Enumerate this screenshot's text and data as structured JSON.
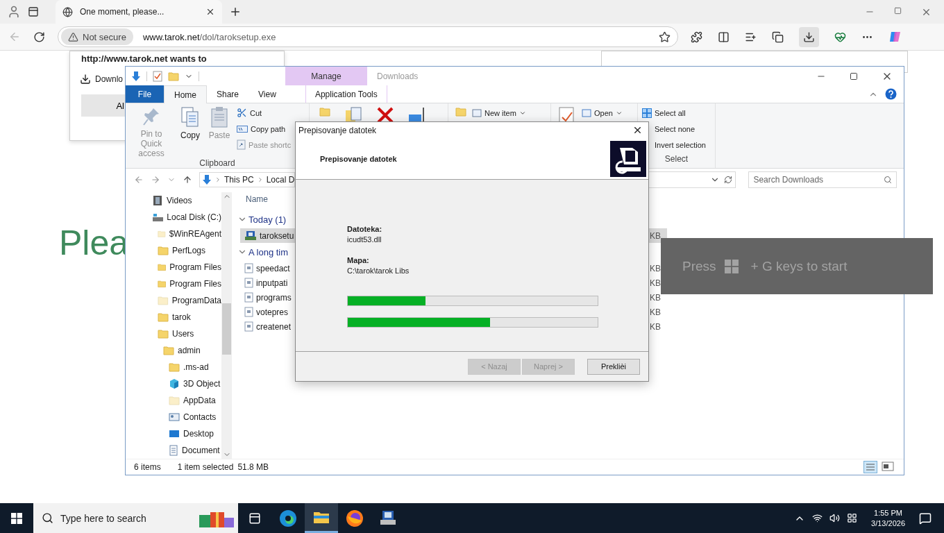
{
  "browser": {
    "tab": {
      "title": "One moment, please..."
    },
    "address": {
      "security": "Not secure",
      "host": "www.tarok.net",
      "path": "/dol/taroksetup.exe"
    },
    "page": {
      "heading": "Plea"
    },
    "download_prompt": {
      "title": "http://www.tarok.net wants to",
      "item": "Downlo",
      "button": "Al"
    }
  },
  "explorer": {
    "context_tab": "Manage",
    "title": "Downloads",
    "tabs": [
      {
        "label": "File",
        "kind": "file",
        "selected": false
      },
      {
        "label": "Home",
        "kind": "tab",
        "selected": true
      },
      {
        "label": "Share",
        "kind": "tab",
        "selected": false
      },
      {
        "label": "View",
        "kind": "tab",
        "selected": false
      },
      {
        "label": "Application Tools",
        "kind": "context",
        "selected": false
      }
    ],
    "clipboard": {
      "label": "Clipboard",
      "large": [
        {
          "label": "Pin to Quick access",
          "kind": "pin",
          "disabled": true
        },
        {
          "label": "Copy",
          "kind": "copy",
          "disabled": false
        },
        {
          "label": "Paste",
          "kind": "paste",
          "disabled": true
        }
      ],
      "small": [
        {
          "label": "Cut",
          "kind": "cut",
          "disabled": false
        },
        {
          "label": "Copy path",
          "kind": "path",
          "disabled": false
        },
        {
          "label": "Paste shortc",
          "kind": "shortcut",
          "disabled": true
        }
      ]
    },
    "new_item": "New item",
    "open": "Open",
    "select": {
      "label": "Select",
      "items": [
        "Select all",
        "Select none",
        "Invert selection"
      ]
    },
    "breadcrumb": [
      "This PC",
      "Local D"
    ],
    "search": {
      "placeholder": "Search Downloads"
    },
    "tree": [
      {
        "label": "Videos",
        "kind": "video"
      },
      {
        "label": "Local Disk (C:)",
        "kind": "drive",
        "children": [
          {
            "label": "$WinREAgent",
            "kind": "hidden-folder"
          },
          {
            "label": "PerfLogs",
            "kind": "folder"
          },
          {
            "label": "Program Files",
            "kind": "folder"
          },
          {
            "label": "Program Files",
            "kind": "folder"
          },
          {
            "label": "ProgramData",
            "kind": "hidden-folder"
          },
          {
            "label": "tarok",
            "kind": "folder"
          },
          {
            "label": "Users",
            "kind": "folder",
            "children": [
              {
                "label": "admin",
                "kind": "folder",
                "children": [
                  {
                    "label": ".ms-ad",
                    "kind": "folder"
                  },
                  {
                    "label": "3D Object",
                    "kind": "cube"
                  },
                  {
                    "label": "AppData",
                    "kind": "hidden-folder"
                  },
                  {
                    "label": "Contacts",
                    "kind": "contacts"
                  },
                  {
                    "label": "Desktop",
                    "kind": "desktop"
                  },
                  {
                    "label": "Document",
                    "kind": "document"
                  }
                ]
              }
            ]
          }
        ]
      }
    ],
    "column": "Name",
    "groups": [
      {
        "label": "Today (1)",
        "expanded": true,
        "files": [
          {
            "name": "taroksetu",
            "size": "KB",
            "kind": "exe",
            "selected": true
          }
        ]
      },
      {
        "label": "A long tim",
        "expanded": true,
        "files": [
          {
            "name": "speedact",
            "size": "KB",
            "kind": "file",
            "selected": false
          },
          {
            "name": "inputpati",
            "size": "KB",
            "kind": "file",
            "selected": false
          },
          {
            "name": "programs",
            "size": "KB",
            "kind": "file",
            "selected": false
          },
          {
            "name": "votepres",
            "size": "KB",
            "kind": "file",
            "selected": false
          },
          {
            "name": "createnet",
            "size": "KB",
            "kind": "file",
            "selected": false
          }
        ]
      }
    ],
    "status": {
      "count": "6 items",
      "selection": "1 item selected",
      "size": "51.8 MB"
    }
  },
  "dialog": {
    "title": "Prepisovanje datotek",
    "heading": "Prepisovanje datotek",
    "fields": [
      {
        "label": "Datoteka:",
        "value": "icudt53.dll"
      },
      {
        "label": "Mapa:",
        "value": "C:\\tarok\\tarok Libs"
      }
    ],
    "progress": [
      {
        "level": 0.31
      },
      {
        "level": 0.57
      }
    ],
    "buttons": [
      {
        "label": "< Nazaj",
        "disabled": true
      },
      {
        "label": "Naprej >",
        "disabled": true
      },
      {
        "label": "Preklièi",
        "disabled": false
      }
    ]
  },
  "game_bar": {
    "before": "Press",
    "after": "+ G keys to start"
  },
  "taskbar": {
    "search": "Type here to search",
    "apps": [
      {
        "kind": "taskview",
        "active": false
      },
      {
        "kind": "edge",
        "active": false
      },
      {
        "kind": "explorer",
        "active": true
      },
      {
        "kind": "firefox",
        "active": false
      },
      {
        "kind": "installer",
        "active": false
      }
    ],
    "time": "1:55 PM",
    "date": "3/13/2026"
  }
}
